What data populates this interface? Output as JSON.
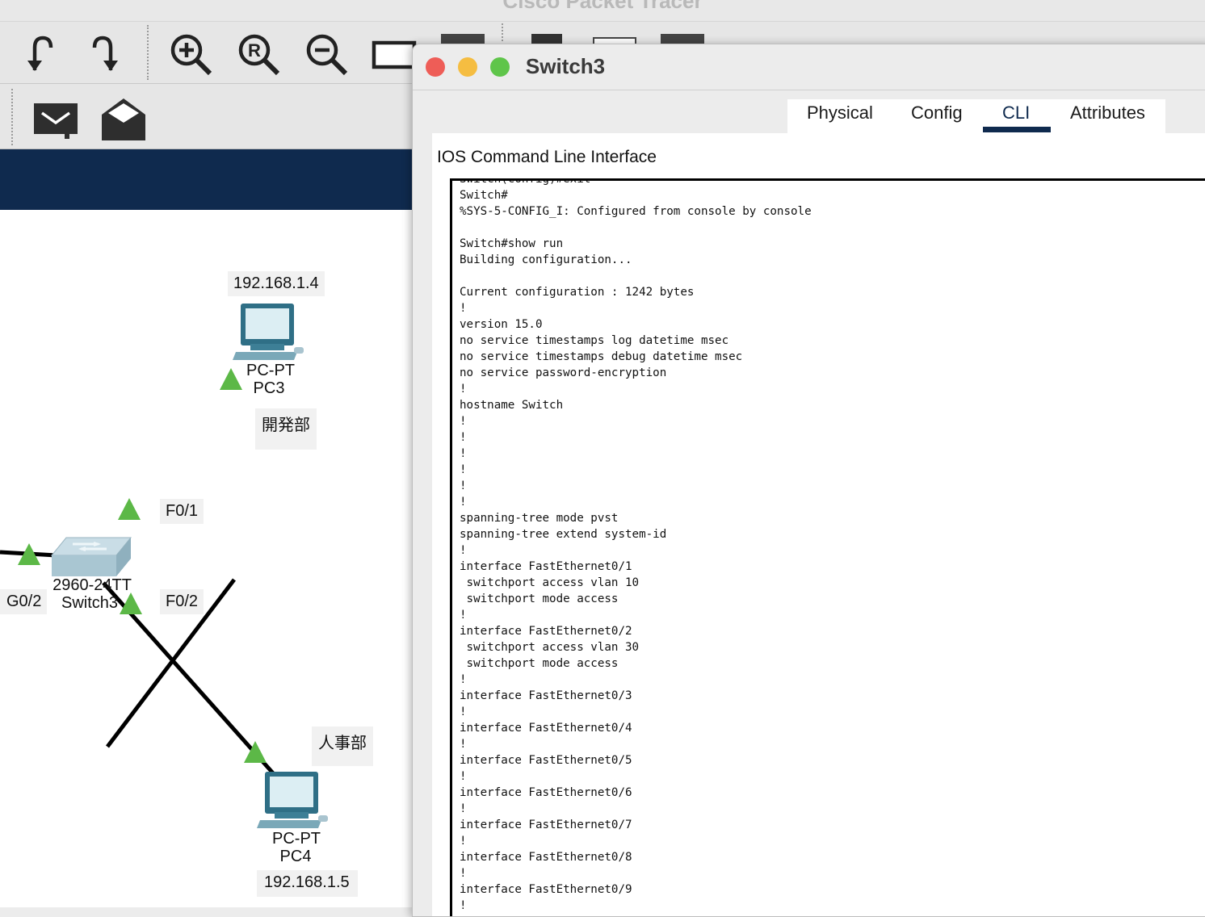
{
  "app": {
    "title": "Cisco Packet Tracer"
  },
  "toolbar": {
    "undo": "undo-icon",
    "redo": "redo-icon",
    "zoom_in": "zoom-in-icon",
    "zoom_reset": "zoom-reset-icon",
    "zoom_out": "zoom-out-icon",
    "simple_pdu": "closed-envelope-icon",
    "complex_pdu": "open-envelope-icon"
  },
  "topology": {
    "pc3": {
      "ip": "192.168.1.4",
      "model": "PC-PT",
      "name": "PC3",
      "dept": "開発部"
    },
    "pc4": {
      "ip": "192.168.1.5",
      "model": "PC-PT",
      "name": "PC4",
      "dept": "人事部"
    },
    "switch": {
      "model": "2960-24TT",
      "name": "Switch3"
    },
    "ports": {
      "f01": "F0/1",
      "f02": "F0/2",
      "g02": "G0/2"
    },
    "link_color": "#000000",
    "link_status_color": "#5cb847"
  },
  "dialog": {
    "title": "Switch3",
    "tabs": [
      "Physical",
      "Config",
      "CLI",
      "Attributes"
    ],
    "active_tab": "CLI",
    "cli_heading": "IOS Command Line Interface",
    "terminal_output": "Switch(config)#exit\nSwitch#\n%SYS-5-CONFIG_I: Configured from console by console\n\nSwitch#show run\nBuilding configuration...\n\nCurrent configuration : 1242 bytes\n!\nversion 15.0\nno service timestamps log datetime msec\nno service timestamps debug datetime msec\nno service password-encryption\n!\nhostname Switch\n!\n!\n!\n!\n!\n!\nspanning-tree mode pvst\nspanning-tree extend system-id\n!\ninterface FastEthernet0/1\n switchport access vlan 10\n switchport mode access\n!\ninterface FastEthernet0/2\n switchport access vlan 30\n switchport mode access\n!\ninterface FastEthernet0/3\n!\ninterface FastEthernet0/4\n!\ninterface FastEthernet0/5\n!\ninterface FastEthernet0/6\n!\ninterface FastEthernet0/7\n!\ninterface FastEthernet0/8\n!\ninterface FastEthernet0/9\n!",
    "window_controls": {
      "close_color": "#ee5d57",
      "minimize_color": "#f5bd41",
      "maximize_color": "#5fc54a"
    }
  }
}
